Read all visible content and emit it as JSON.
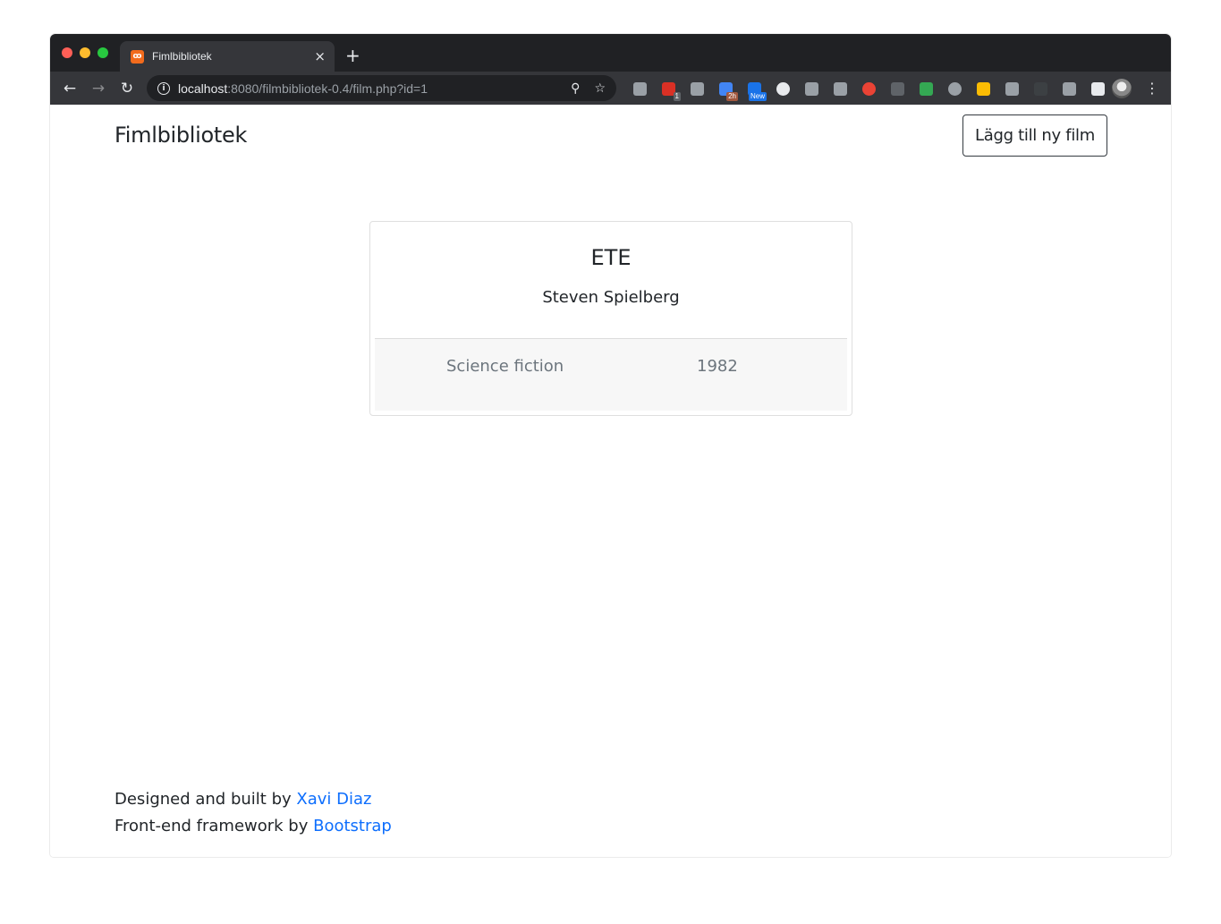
{
  "browser": {
    "tab": {
      "title": "Fimlbibliotek",
      "favicon": "xampp-icon",
      "close": "×"
    },
    "new_tab": "+",
    "nav": {
      "back": "←",
      "forward": "→",
      "reload": "↻"
    },
    "omnibox": {
      "host": "localhost",
      "path": ":8080/filmbibliotek-0.4/film.php?id=1",
      "info": "i",
      "zoom": "⚲",
      "bookmark": "☆"
    },
    "extensions": [
      {
        "name": "drive-ext-icon",
        "color": "#9aa0a6",
        "badge": ""
      },
      {
        "name": "todo-ext-icon",
        "color": "#d93025",
        "badge": "1",
        "badge_color": "#5f6368"
      },
      {
        "name": "lightbulb-ext-icon",
        "color": "#9aa0a6",
        "badge": ""
      },
      {
        "name": "calendar-ext-icon",
        "color": "#4285f4",
        "badge": "2h",
        "badge_color": "#a1583e"
      },
      {
        "name": "s-ext-icon",
        "color": "#1a73e8",
        "badge": "New",
        "badge_color": "#1a73e8"
      },
      {
        "name": "circle-ext-icon",
        "color": "#e8eaed",
        "badge": ""
      },
      {
        "name": "camera-ext-icon",
        "color": "#9aa0a6",
        "badge": ""
      },
      {
        "name": "screenshot-ext-icon",
        "color": "#9aa0a6",
        "badge": ""
      },
      {
        "name": "color-wheel-ext-icon",
        "color": "#ea4335",
        "badge": ""
      },
      {
        "name": "facebook-ext-icon",
        "color": "#5f6368",
        "badge": ""
      },
      {
        "name": "chart-ext-icon",
        "color": "#34a853",
        "badge": ""
      },
      {
        "name": "download-circle-ext-icon",
        "color": "#9aa0a6",
        "badge": ""
      },
      {
        "name": "google-drive-ext-icon",
        "color": "#fbbc04",
        "badge": ""
      },
      {
        "name": "pin-ext-icon",
        "color": "#9aa0a6",
        "badge": ""
      },
      {
        "name": "cloud-ext-icon",
        "color": "#3c4043",
        "badge": ""
      },
      {
        "name": "download-arrow-ext-icon",
        "color": "#9aa0a6",
        "badge": ""
      },
      {
        "name": "puzzle-ext-icon",
        "color": "#e8eaed",
        "badge": ""
      }
    ],
    "menu": "⋮"
  },
  "page": {
    "brand": "Fimlbibliotek",
    "add_button": "Lägg till ny film",
    "film": {
      "title": "ETE",
      "director": "Steven Spielberg",
      "genre": "Science fiction",
      "year": "1982"
    },
    "footer": {
      "line1_prefix": "Designed and built by ",
      "line1_link": "Xavi Diaz",
      "line2_prefix": "Front-end framework by ",
      "line2_link": "Bootstrap"
    }
  }
}
